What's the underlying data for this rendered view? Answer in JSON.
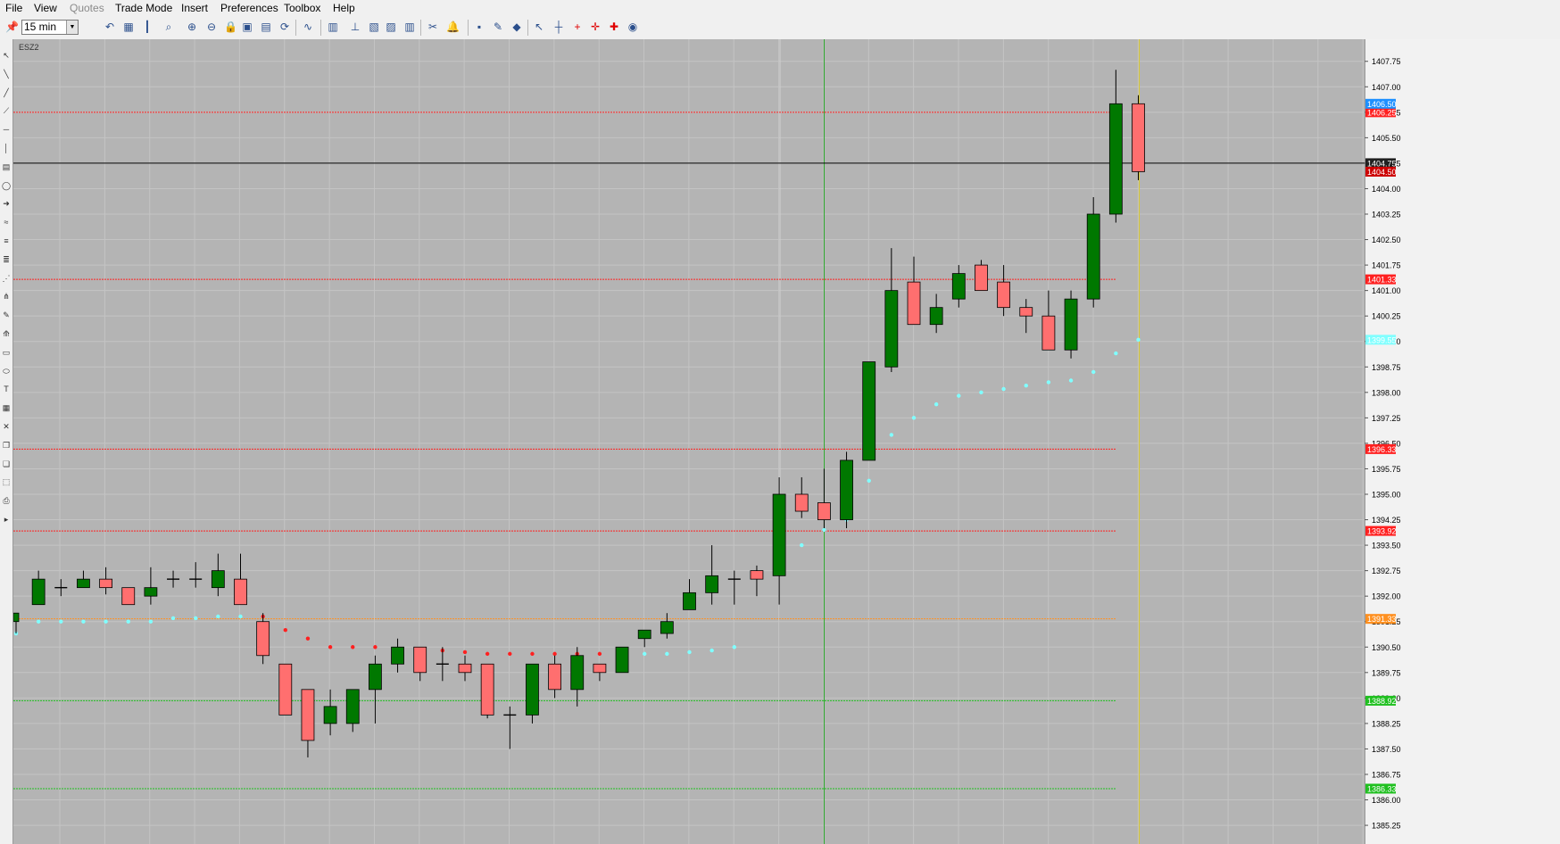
{
  "menu": [
    "File",
    "View",
    "Quotes",
    "Trade Mode",
    "Insert",
    "Preferences",
    "Toolbox",
    "Help"
  ],
  "menu_disabled": [
    "Quotes"
  ],
  "toolbar": {
    "interval_value": "15 min",
    "icons": [
      "pin-icon",
      "redo-icon",
      "undo-icon",
      "grid-icon",
      "bar-type-icon",
      "zoom-icon",
      "zoom-in-icon",
      "zoom-out-icon",
      "lock-icon",
      "fit-icon",
      "page-icon",
      "refresh-icon",
      "wave-icon",
      "indicator-icon",
      "hierarchy-icon",
      "chart-box-icon",
      "color-icon",
      "bars-icon",
      "scissors-icon",
      "alert-bell-icon",
      "save-icon",
      "edit-icon",
      "eraser-icon",
      "pointer-icon",
      "crosshair-icon",
      "cross-red-icon",
      "cross-dot-icon",
      "cross-bold-icon",
      "globe-icon"
    ]
  },
  "left_tools": [
    "select-arrow-icon",
    "line-icon",
    "ray-icon",
    "trend-icon",
    "hline-icon",
    "vline-icon",
    "note-icon",
    "ellipse-tool-icon",
    "arrow-tool-icon",
    "channel-icon",
    "fib-icon",
    "fib-ext-icon",
    "gann-icon",
    "pitchfork-icon",
    "pencil-icon",
    "fan-icon",
    "rectangle-icon",
    "oval-icon",
    "text-icon",
    "table-icon",
    "delete-icon",
    "copy-icon",
    "paste-icon",
    "select-box-icon",
    "print-icon",
    "more-icon"
  ],
  "chart_data": {
    "type": "candlestick",
    "symbol": "ESZ2",
    "ylim": [
      1384.7,
      1408.4
    ],
    "y_ticks": [
      1385.25,
      1386.0,
      1386.75,
      1387.5,
      1388.25,
      1389.0,
      1389.75,
      1390.5,
      1391.25,
      1392.0,
      1392.75,
      1393.5,
      1394.25,
      1395.0,
      1395.75,
      1396.5,
      1397.25,
      1398.0,
      1398.75,
      1399.5,
      1400.25,
      1401.0,
      1401.75,
      1402.5,
      1403.25,
      1404.0,
      1404.75,
      1405.5,
      1406.25,
      1407.0,
      1407.75
    ],
    "candles": [
      {
        "o": 1391.25,
        "h": 1391.5,
        "l": 1390.9,
        "c": 1391.5
      },
      {
        "o": 1391.75,
        "h": 1392.75,
        "l": 1391.75,
        "c": 1392.5
      },
      {
        "o": 1392.25,
        "h": 1392.5,
        "l": 1392.0,
        "c": 1392.25
      },
      {
        "o": 1392.25,
        "h": 1392.75,
        "l": 1392.25,
        "c": 1392.5
      },
      {
        "o": 1392.5,
        "h": 1392.85,
        "l": 1392.05,
        "c": 1392.25
      },
      {
        "o": 1392.25,
        "h": 1392.25,
        "l": 1391.75,
        "c": 1391.75
      },
      {
        "o": 1392.0,
        "h": 1392.85,
        "l": 1391.75,
        "c": 1392.25
      },
      {
        "o": 1392.5,
        "h": 1392.75,
        "l": 1392.25,
        "c": 1392.5
      },
      {
        "o": 1392.5,
        "h": 1393.0,
        "l": 1392.25,
        "c": 1392.5
      },
      {
        "o": 1392.25,
        "h": 1393.25,
        "l": 1392.0,
        "c": 1392.75
      },
      {
        "o": 1392.5,
        "h": 1393.25,
        "l": 1391.75,
        "c": 1391.75
      },
      {
        "o": 1391.25,
        "h": 1391.5,
        "l": 1390.0,
        "c": 1390.25
      },
      {
        "o": 1390.0,
        "h": 1390.0,
        "l": 1388.5,
        "c": 1388.5
      },
      {
        "o": 1389.25,
        "h": 1389.25,
        "l": 1387.25,
        "c": 1387.75
      },
      {
        "o": 1388.25,
        "h": 1389.25,
        "l": 1387.9,
        "c": 1388.75
      },
      {
        "o": 1388.25,
        "h": 1389.25,
        "l": 1388.0,
        "c": 1389.25
      },
      {
        "o": 1389.25,
        "h": 1390.25,
        "l": 1388.25,
        "c": 1390.0
      },
      {
        "o": 1390.0,
        "h": 1390.75,
        "l": 1389.75,
        "c": 1390.5
      },
      {
        "o": 1390.5,
        "h": 1390.5,
        "l": 1389.5,
        "c": 1389.75
      },
      {
        "o": 1390.0,
        "h": 1390.5,
        "l": 1389.5,
        "c": 1390.0
      },
      {
        "o": 1390.0,
        "h": 1390.25,
        "l": 1389.5,
        "c": 1389.75
      },
      {
        "o": 1390.0,
        "h": 1390.0,
        "l": 1388.4,
        "c": 1388.5
      },
      {
        "o": 1388.5,
        "h": 1388.75,
        "l": 1387.5,
        "c": 1388.5
      },
      {
        "o": 1388.5,
        "h": 1390.0,
        "l": 1388.25,
        "c": 1390.0
      },
      {
        "o": 1390.0,
        "h": 1390.25,
        "l": 1389.0,
        "c": 1389.25
      },
      {
        "o": 1389.25,
        "h": 1390.5,
        "l": 1388.75,
        "c": 1390.25
      },
      {
        "o": 1390.0,
        "h": 1390.0,
        "l": 1389.5,
        "c": 1389.75
      },
      {
        "o": 1389.75,
        "h": 1390.5,
        "l": 1389.75,
        "c": 1390.5
      },
      {
        "o": 1390.75,
        "h": 1391.0,
        "l": 1390.5,
        "c": 1391.0
      },
      {
        "o": 1390.9,
        "h": 1391.5,
        "l": 1390.75,
        "c": 1391.25
      },
      {
        "o": 1391.6,
        "h": 1392.5,
        "l": 1391.6,
        "c": 1392.1
      },
      {
        "o": 1392.1,
        "h": 1393.5,
        "l": 1391.75,
        "c": 1392.6
      },
      {
        "o": 1392.5,
        "h": 1392.75,
        "l": 1391.75,
        "c": 1392.5
      },
      {
        "o": 1392.75,
        "h": 1392.9,
        "l": 1392.0,
        "c": 1392.5
      },
      {
        "o": 1392.6,
        "h": 1395.5,
        "l": 1391.75,
        "c": 1395.0
      },
      {
        "o": 1395.0,
        "h": 1395.5,
        "l": 1394.3,
        "c": 1394.5
      },
      {
        "o": 1394.75,
        "h": 1395.75,
        "l": 1394.0,
        "c": 1394.25
      },
      {
        "o": 1394.25,
        "h": 1396.25,
        "l": 1394.0,
        "c": 1396.0
      },
      {
        "o": 1396.0,
        "h": 1398.9,
        "l": 1396.0,
        "c": 1398.9
      },
      {
        "o": 1398.75,
        "h": 1402.25,
        "l": 1398.6,
        "c": 1401.0
      },
      {
        "o": 1401.25,
        "h": 1402.0,
        "l": 1400.0,
        "c": 1400.0
      },
      {
        "o": 1400.0,
        "h": 1400.9,
        "l": 1399.75,
        "c": 1400.5
      },
      {
        "o": 1400.75,
        "h": 1401.75,
        "l": 1400.5,
        "c": 1401.5
      },
      {
        "o": 1401.75,
        "h": 1401.9,
        "l": 1401.0,
        "c": 1401.0
      },
      {
        "o": 1401.25,
        "h": 1401.75,
        "l": 1400.25,
        "c": 1400.5
      },
      {
        "o": 1400.5,
        "h": 1400.75,
        "l": 1399.75,
        "c": 1400.25
      },
      {
        "o": 1400.25,
        "h": 1401.0,
        "l": 1399.5,
        "c": 1399.25
      },
      {
        "o": 1399.25,
        "h": 1401.0,
        "l": 1399.0,
        "c": 1400.75
      },
      {
        "o": 1400.75,
        "h": 1403.75,
        "l": 1400.5,
        "c": 1403.25
      },
      {
        "o": 1403.25,
        "h": 1407.5,
        "l": 1403.0,
        "c": 1406.5
      },
      {
        "o": 1406.5,
        "h": 1406.75,
        "l": 1404.25,
        "c": 1404.5
      }
    ],
    "psar": [
      {
        "i": 0,
        "v": 1390.9,
        "side": "up"
      },
      {
        "i": 1,
        "v": 1391.25,
        "side": "up"
      },
      {
        "i": 2,
        "v": 1391.25,
        "side": "up"
      },
      {
        "i": 3,
        "v": 1391.25,
        "side": "up"
      },
      {
        "i": 4,
        "v": 1391.25,
        "side": "up"
      },
      {
        "i": 5,
        "v": 1391.25,
        "side": "up"
      },
      {
        "i": 6,
        "v": 1391.25,
        "side": "up"
      },
      {
        "i": 7,
        "v": 1391.35,
        "side": "up"
      },
      {
        "i": 8,
        "v": 1391.35,
        "side": "up"
      },
      {
        "i": 9,
        "v": 1391.4,
        "side": "up"
      },
      {
        "i": 10,
        "v": 1391.4,
        "side": "up"
      },
      {
        "i": 11,
        "v": 1391.4,
        "side": "down"
      },
      {
        "i": 12,
        "v": 1391.0,
        "side": "down"
      },
      {
        "i": 13,
        "v": 1390.75,
        "side": "down"
      },
      {
        "i": 14,
        "v": 1390.5,
        "side": "down"
      },
      {
        "i": 15,
        "v": 1390.5,
        "side": "down"
      },
      {
        "i": 16,
        "v": 1390.5,
        "side": "down"
      },
      {
        "i": 17,
        "v": 1390.4,
        "side": "down"
      },
      {
        "i": 18,
        "v": 1390.4,
        "side": "down"
      },
      {
        "i": 19,
        "v": 1390.4,
        "side": "down"
      },
      {
        "i": 20,
        "v": 1390.35,
        "side": "down"
      },
      {
        "i": 21,
        "v": 1390.3,
        "side": "down"
      },
      {
        "i": 22,
        "v": 1390.3,
        "side": "down"
      },
      {
        "i": 23,
        "v": 1390.3,
        "side": "down"
      },
      {
        "i": 24,
        "v": 1390.3,
        "side": "down"
      },
      {
        "i": 25,
        "v": 1390.3,
        "side": "down"
      },
      {
        "i": 26,
        "v": 1390.3,
        "side": "down"
      },
      {
        "i": 27,
        "v": 1390.3,
        "side": "down"
      },
      {
        "i": 28,
        "v": 1390.3,
        "side": "up"
      },
      {
        "i": 29,
        "v": 1390.3,
        "side": "up"
      },
      {
        "i": 30,
        "v": 1390.35,
        "side": "up"
      },
      {
        "i": 31,
        "v": 1390.4,
        "side": "up"
      },
      {
        "i": 32,
        "v": 1390.5,
        "side": "up"
      },
      {
        "i": 34,
        "v": 1393.0,
        "side": "up"
      },
      {
        "i": 35,
        "v": 1393.5,
        "side": "up"
      },
      {
        "i": 36,
        "v": 1393.95,
        "side": "up"
      },
      {
        "i": 37,
        "v": 1394.25,
        "side": "up"
      },
      {
        "i": 38,
        "v": 1395.4,
        "side": "up"
      },
      {
        "i": 39,
        "v": 1396.75,
        "side": "up"
      },
      {
        "i": 40,
        "v": 1397.25,
        "side": "up"
      },
      {
        "i": 41,
        "v": 1397.65,
        "side": "up"
      },
      {
        "i": 42,
        "v": 1397.9,
        "side": "up"
      },
      {
        "i": 43,
        "v": 1398.0,
        "side": "up"
      },
      {
        "i": 44,
        "v": 1398.1,
        "side": "up"
      },
      {
        "i": 45,
        "v": 1398.2,
        "side": "up"
      },
      {
        "i": 46,
        "v": 1398.3,
        "side": "up"
      },
      {
        "i": 47,
        "v": 1398.35,
        "side": "up"
      },
      {
        "i": 48,
        "v": 1398.6,
        "side": "up"
      },
      {
        "i": 49,
        "v": 1399.15,
        "side": "up"
      },
      {
        "i": 50,
        "v": 1399.55,
        "side": "up"
      }
    ],
    "levels": [
      {
        "v": 1406.25,
        "color": "#ff2020",
        "label": "1406.25",
        "style": "dotted"
      },
      {
        "v": 1401.33,
        "color": "#ff2020",
        "label": "1401.33",
        "style": "dotted"
      },
      {
        "v": 1396.33,
        "color": "#ff2020",
        "label": "1396.33",
        "style": "dotted"
      },
      {
        "v": 1393.92,
        "color": "#ff2020",
        "label": "1393.92",
        "style": "dotted"
      },
      {
        "v": 1391.33,
        "color": "#ff9020",
        "label": "1391.33",
        "style": "dotted"
      },
      {
        "v": 1388.92,
        "color": "#20c020",
        "label": "1388.92",
        "style": "dotted"
      },
      {
        "v": 1386.33,
        "color": "#20c020",
        "label": "1386.33",
        "style": "dotted"
      }
    ],
    "price_tags": [
      {
        "v": 1406.5,
        "label": "1406.50",
        "bg": "#1e90ff",
        "fg": "#ffffff"
      },
      {
        "v": 1404.75,
        "label": "1404.75",
        "bg": "#202020",
        "fg": "#ffffff"
      },
      {
        "v": 1404.5,
        "label": "1404.50",
        "bg": "#cc0000",
        "fg": "#ffffff"
      },
      {
        "v": 1399.55,
        "label": "1399.55",
        "bg": "#80ffff",
        "fg": "#ffffff"
      }
    ],
    "crosshair_price": 1404.75,
    "colors": {
      "bg": "#b4b4b4",
      "up": "#007800",
      "down": "#ff6f6f",
      "psar_up": "#80ffff",
      "psar_down": "#ff2020",
      "grid": "#c4c4c4",
      "axis_bg": "#f2f2f2"
    }
  }
}
